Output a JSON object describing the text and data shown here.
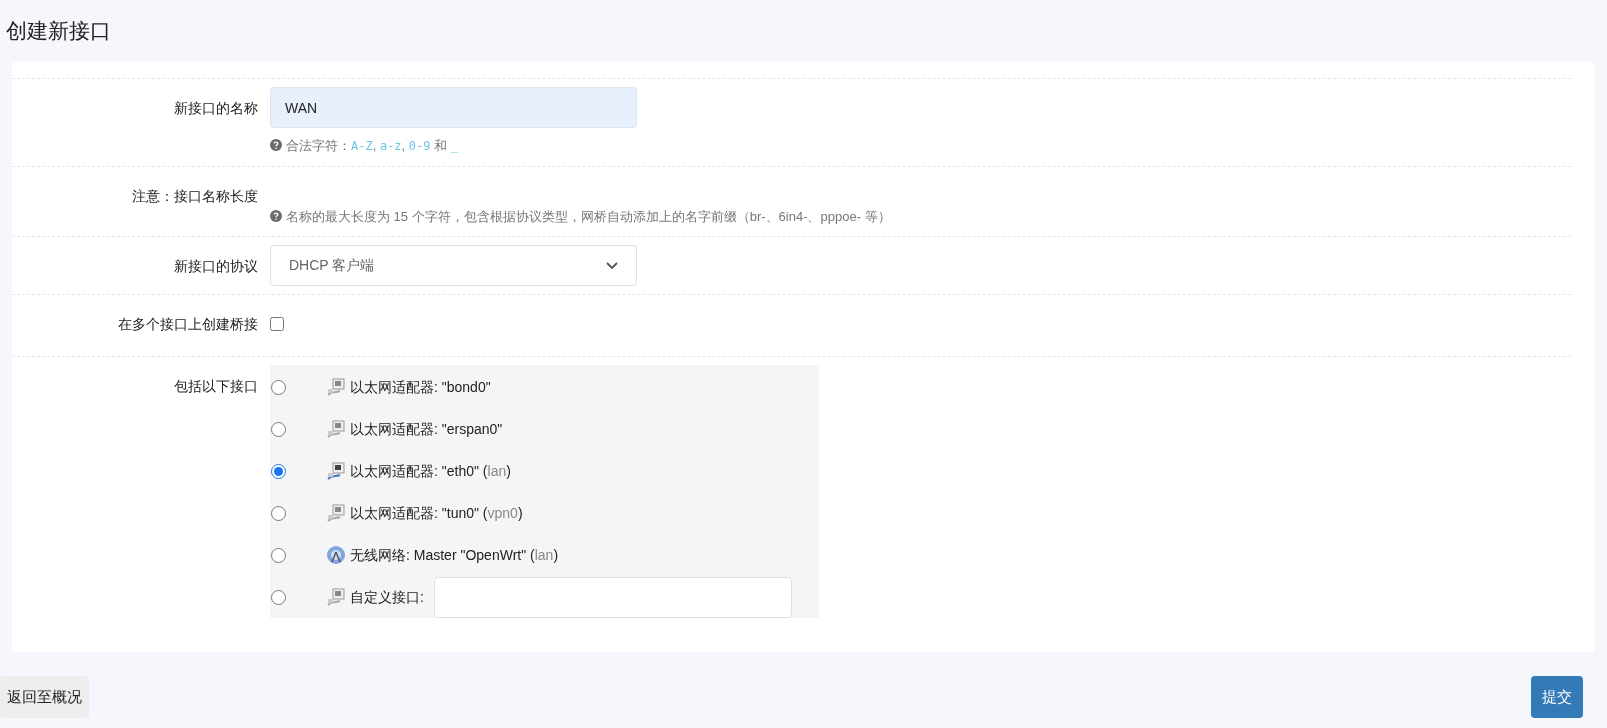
{
  "title": "创建新接口",
  "name_field": {
    "label": "新接口的名称",
    "value": "WAN",
    "hint": [
      {
        "kind": "text",
        "text": "合法字符："
      },
      {
        "kind": "code",
        "text": "A-Z"
      },
      {
        "kind": "text",
        "text": ", "
      },
      {
        "kind": "code",
        "text": "a-z"
      },
      {
        "kind": "text",
        "text": ", "
      },
      {
        "kind": "code",
        "text": "0-9"
      },
      {
        "kind": "text",
        "text": " 和 "
      },
      {
        "kind": "code",
        "text": "_"
      }
    ]
  },
  "note": {
    "label": "注意：接口名称长度",
    "hint": "名称的最大长度为 15 个字符，包含根据协议类型，网桥自动添加上的名字前缀（br-、6in4-、pppoe- 等）"
  },
  "protocol": {
    "label": "新接口的协议",
    "value": "DHCP 客户端"
  },
  "bridge": {
    "label": "在多个接口上创建桥接",
    "checked": false
  },
  "interfaces": {
    "label": "包括以下接口",
    "items": [
      {
        "kind": "ethernet",
        "label": "以太网适配器: \"bond0\"",
        "selected": false
      },
      {
        "kind": "ethernet",
        "label": "以太网适配器: \"erspan0\"",
        "selected": false
      },
      {
        "kind": "ethernet",
        "label": "以太网适配器: \"eth0\"",
        "network": "(lan)",
        "selected": true
      },
      {
        "kind": "ethernet",
        "label": "以太网适配器: \"tun0\"",
        "network": "(vpn0)",
        "selected": false
      },
      {
        "kind": "wireless",
        "label": "无线网络: Master \"OpenWrt\"",
        "network": "(lan)",
        "selected": false
      },
      {
        "kind": "custom",
        "label": "自定义接口:",
        "selected": false
      }
    ]
  },
  "buttons": {
    "back": "返回至概况",
    "submit": "提交"
  }
}
